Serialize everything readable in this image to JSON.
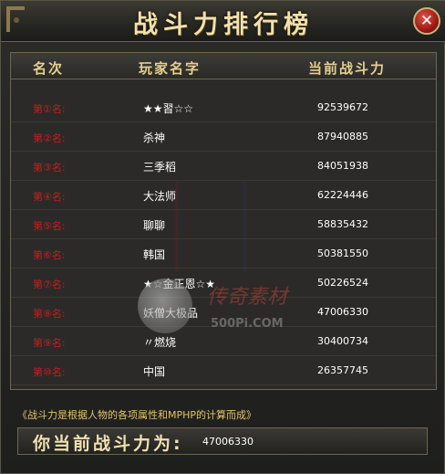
{
  "window": {
    "title": "战斗力排行榜",
    "close_symbol": "✕"
  },
  "columns": {
    "rank": "名次",
    "player": "玩家名字",
    "power": "当前战斗力"
  },
  "rows": [
    {
      "rank": "第①名:",
      "name": "★★習☆☆",
      "power": "92539672"
    },
    {
      "rank": "第②名:",
      "name": "杀神",
      "power": "87940885"
    },
    {
      "rank": "第③名:",
      "name": "三季稻",
      "power": "84051938"
    },
    {
      "rank": "第④名:",
      "name": "大法师",
      "power": "62224446"
    },
    {
      "rank": "第⑤名:",
      "name": "聊聊",
      "power": "58835432"
    },
    {
      "rank": "第⑥名:",
      "name": "韩国",
      "power": "50381550"
    },
    {
      "rank": "第⑦名:",
      "name": "★☆金正恩☆★",
      "power": "50226524"
    },
    {
      "rank": "第⑧名:",
      "name": "妖僧大极品",
      "power": "47006330"
    },
    {
      "rank": "第⑨名:",
      "name": "〃燃烧",
      "power": "30400734"
    },
    {
      "rank": "第⑩名:",
      "name": "中国",
      "power": "26357745"
    }
  ],
  "note": "《战斗力是根据人物的各项属性和MPHP的计算而成》",
  "current": {
    "label": "你当前战斗力为:",
    "value": "47006330"
  },
  "watermark": {
    "brand": "传奇素材",
    "url": "500Pi.COM"
  },
  "colors": {
    "rank_red": "#c81e1e",
    "gold_text": "#e6cf8f",
    "note_yellow": "#e1c36a"
  }
}
